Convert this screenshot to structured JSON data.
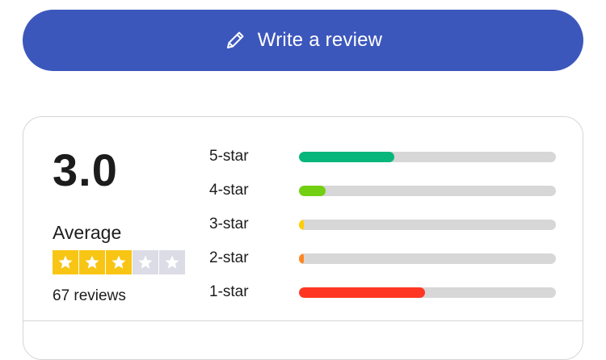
{
  "write_review": {
    "label": "Write a review",
    "icon": "pencil-icon",
    "color": "#3c57bc"
  },
  "summary": {
    "score": "3.0",
    "verdict": "Average",
    "stars_filled": 3,
    "stars_total": 5,
    "star_color": "#f8c514",
    "review_count": "67 reviews"
  },
  "distribution": [
    {
      "label": "5-star",
      "fraction": 0.37,
      "color": "#06b67a"
    },
    {
      "label": "4-star",
      "fraction": 0.105,
      "color": "#73cf11"
    },
    {
      "label": "3-star",
      "fraction": 0.02,
      "color": "#ffce00"
    },
    {
      "label": "2-star",
      "fraction": 0.02,
      "color": "#ff8622"
    },
    {
      "label": "1-star",
      "fraction": 0.49,
      "color": "#ff3722"
    }
  ]
}
